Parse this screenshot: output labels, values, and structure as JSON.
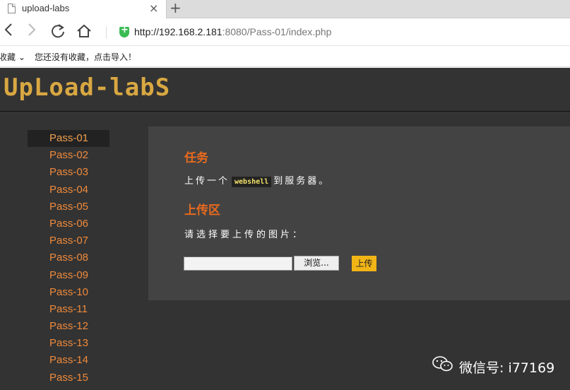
{
  "browser": {
    "tab_title": "upload-labs",
    "tab_close": "×",
    "new_tab": "+",
    "url_host": "http://192.168.2.181",
    "url_rest": ":8080/Pass-01/index.php",
    "bookmarks_label": "收藏",
    "bookmarks_hint": "您还没有收藏，点击导入！"
  },
  "site": {
    "logo": "UpLoad-labS"
  },
  "sidebar": {
    "items": [
      {
        "label": "Pass-01"
      },
      {
        "label": "Pass-02"
      },
      {
        "label": "Pass-03"
      },
      {
        "label": "Pass-04"
      },
      {
        "label": "Pass-05"
      },
      {
        "label": "Pass-06"
      },
      {
        "label": "Pass-07"
      },
      {
        "label": "Pass-08"
      },
      {
        "label": "Pass-09"
      },
      {
        "label": "Pass-10"
      },
      {
        "label": "Pass-11"
      },
      {
        "label": "Pass-12"
      },
      {
        "label": "Pass-13"
      },
      {
        "label": "Pass-14"
      },
      {
        "label": "Pass-15"
      }
    ]
  },
  "task": {
    "heading": "任务",
    "text_before": "上传一个",
    "code": "webshell",
    "text_after": "到服务器。"
  },
  "upload": {
    "heading": "上传区",
    "prompt": "请选择要上传的图片：",
    "browse_label": "浏览...",
    "submit_label": "上传"
  },
  "watermark": {
    "text": "微信号: i77169"
  }
}
